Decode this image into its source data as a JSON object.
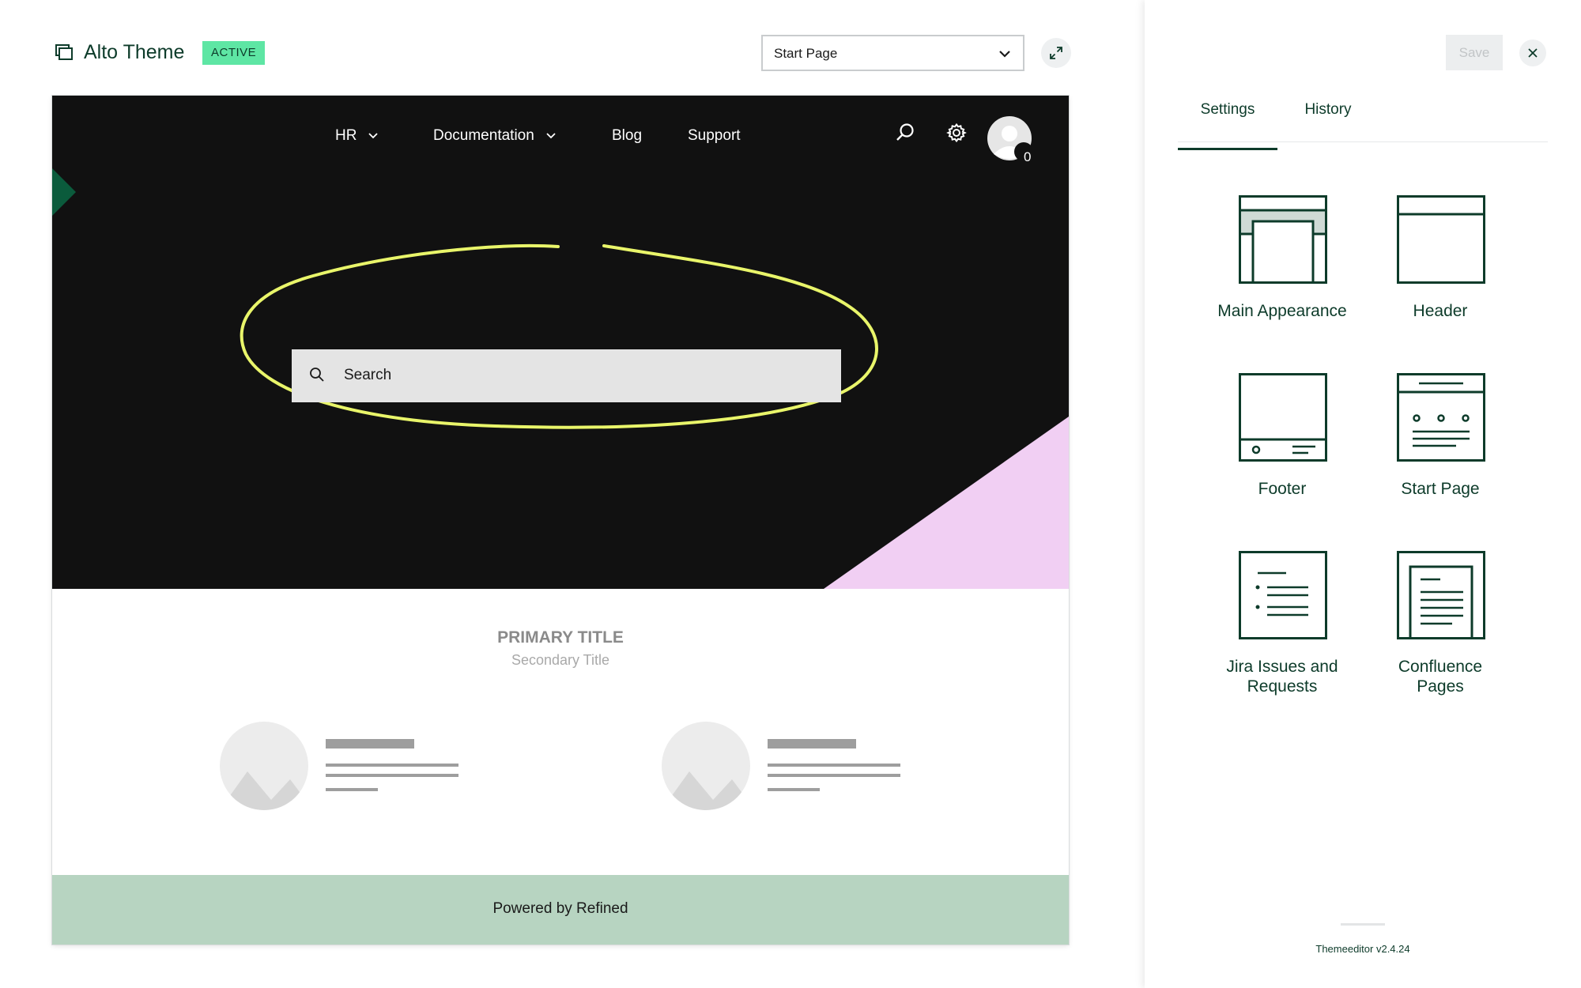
{
  "header": {
    "title": "Alto Theme",
    "badge": "ACTIVE",
    "page_select": {
      "value": "Start Page"
    },
    "icons": [
      "window-icon",
      "chevron-down-icon",
      "expand-icon"
    ]
  },
  "preview": {
    "nav": {
      "items": [
        {
          "label": "HR",
          "has_dropdown": true
        },
        {
          "label": "Documentation",
          "has_dropdown": true
        },
        {
          "label": "Blog",
          "has_dropdown": false
        },
        {
          "label": "Support",
          "has_dropdown": false
        }
      ],
      "notification_count": "0"
    },
    "search": {
      "placeholder": "Search"
    },
    "primary_title": "PRIMARY TITLE",
    "secondary_title": "Secondary Title",
    "footer": "Powered by Refined",
    "colors": {
      "hero_bg": "#111111",
      "accent_pink": "#f1cff3",
      "accent_green": "#0b5b3c",
      "highlight": "#e9f56a",
      "footer_bg": "#b7d4c1"
    }
  },
  "panel": {
    "save_label": "Save",
    "tabs": [
      {
        "label": "Settings",
        "active": true
      },
      {
        "label": "History",
        "active": false
      }
    ],
    "tiles": [
      {
        "label": "Main Appearance",
        "icon": "main-appearance-icon"
      },
      {
        "label": "Header",
        "icon": "header-layout-icon"
      },
      {
        "label": "Footer",
        "icon": "footer-layout-icon"
      },
      {
        "label": "Start Page",
        "icon": "start-page-icon"
      },
      {
        "label": "Jira Issues and Requests",
        "icon": "jira-issues-icon"
      },
      {
        "label": "Confluence Pages",
        "icon": "confluence-pages-icon"
      }
    ],
    "version": "Themeeditor v2.4.24"
  }
}
